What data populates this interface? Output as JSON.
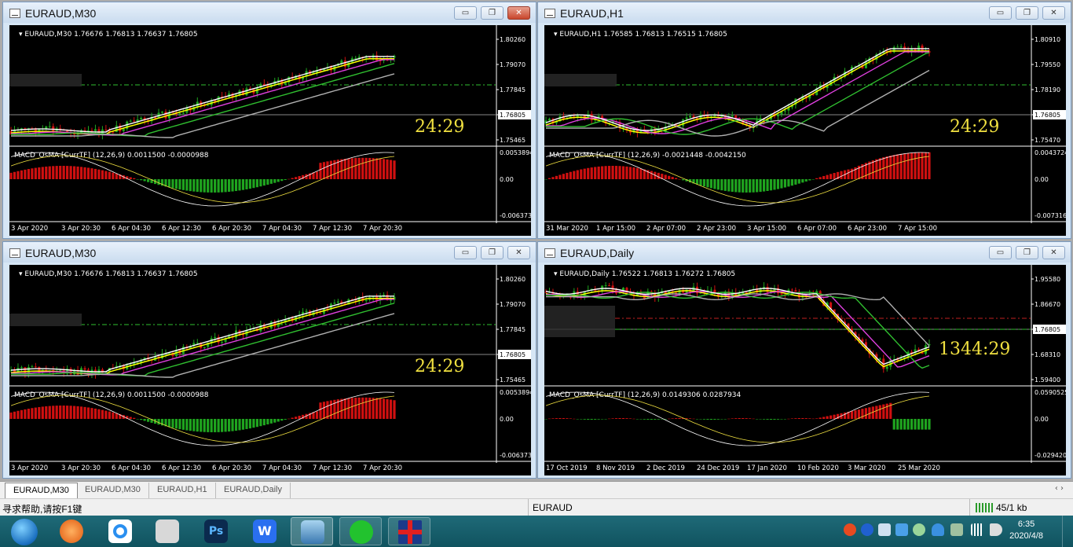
{
  "windows": [
    {
      "title": "EURAUD,M30",
      "header": "EURAUD,M30  1.76676 1.76813 1.76637 1.76805",
      "price_labels": [
        "1.80260",
        "1.79070",
        "1.77845",
        "1.76805",
        "1.75465"
      ],
      "current_price": "1.76805",
      "timer": "24:29",
      "macd_header": "MACD_OsMA [CurrTF] (12,26,9) 0.0011500 -0.0000988",
      "macd_labels": [
        "0.0053894",
        "0.00",
        "-0.006373"
      ],
      "time_labels": [
        "3 Apr 2020",
        "3 Apr 20:30",
        "6 Apr 04:30",
        "6 Apr 12:30",
        "6 Apr 20:30",
        "7 Apr 04:30",
        "7 Apr 12:30",
        "7 Apr 20:30"
      ],
      "active": true
    },
    {
      "title": "EURAUD,H1",
      "header": "EURAUD,H1  1.76585 1.76813 1.76515 1.76805",
      "price_labels": [
        "1.80910",
        "1.79550",
        "1.78190",
        "1.76805",
        "1.75470"
      ],
      "current_price": "1.76805",
      "timer": "24:29",
      "macd_header": "MACD_OsMA [CurrTF] (12,26,9) -0.0021448 -0.0042150",
      "macd_labels": [
        "0.0043724",
        "0.00",
        "-0.007316"
      ],
      "time_labels": [
        "31 Mar 2020",
        "1 Apr 15:00",
        "2 Apr 07:00",
        "2 Apr 23:00",
        "3 Apr 15:00",
        "6 Apr 07:00",
        "6 Apr 23:00",
        "7 Apr 15:00"
      ],
      "active": false
    },
    {
      "title": "EURAUD,M30",
      "header": "EURAUD,M30  1.76676 1.76813 1.76637 1.76805",
      "price_labels": [
        "1.80260",
        "1.79070",
        "1.77845",
        "1.76805",
        "1.75465"
      ],
      "current_price": "1.76805",
      "timer": "24:29",
      "macd_header": "MACD_OsMA [CurrTF] (12,26,9) 0.0011500 -0.0000988",
      "macd_labels": [
        "0.0053894",
        "0.00",
        "-0.006373"
      ],
      "time_labels": [
        "3 Apr 2020",
        "3 Apr 20:30",
        "6 Apr 04:30",
        "6 Apr 12:30",
        "6 Apr 20:30",
        "7 Apr 04:30",
        "7 Apr 12:30",
        "7 Apr 20:30"
      ],
      "active": false
    },
    {
      "title": "EURAUD,Daily",
      "header": "EURAUD,Daily  1.76522 1.76813 1.76272 1.76805",
      "price_labels": [
        "1.95580",
        "1.86670",
        "1.76805",
        "1.68310",
        "1.59400"
      ],
      "current_price": "1.76805",
      "timer": "1344:29",
      "macd_header": "MACD_OsMA [CurrTF] (12,26,9) 0.0149306 0.0287934",
      "macd_labels": [
        "0.0590525",
        "0.00",
        "-0.029420"
      ],
      "time_labels": [
        "17 Oct 2019",
        "8 Nov 2019",
        "2 Dec 2019",
        "24 Dec 2019",
        "17 Jan 2020",
        "10 Feb 2020",
        "3 Mar 2020",
        "25 Mar 2020"
      ],
      "active": false
    }
  ],
  "tabs": [
    "EURAUD,M30",
    "EURAUD,M30",
    "EURAUD,H1",
    "EURAUD,Daily"
  ],
  "tab_arrows": "‹ ›",
  "status": {
    "help": "寻求帮助,请按F1键",
    "symbol": "EURAUD",
    "traffic": "45/1 kb"
  },
  "clock": {
    "time": "6:35",
    "date": "2020/4/8"
  },
  "window_buttons": {
    "minimize": "▭",
    "restore": "❐",
    "close": "✕"
  },
  "colors": {
    "up": "#d01010",
    "down": "#1fa51f",
    "timer": "#f0e040",
    "ma_fast": "#ffff00",
    "ma_slow": "#e040e0",
    "ma_mid": "#30c030",
    "ma_long": "#b0b0b0"
  }
}
